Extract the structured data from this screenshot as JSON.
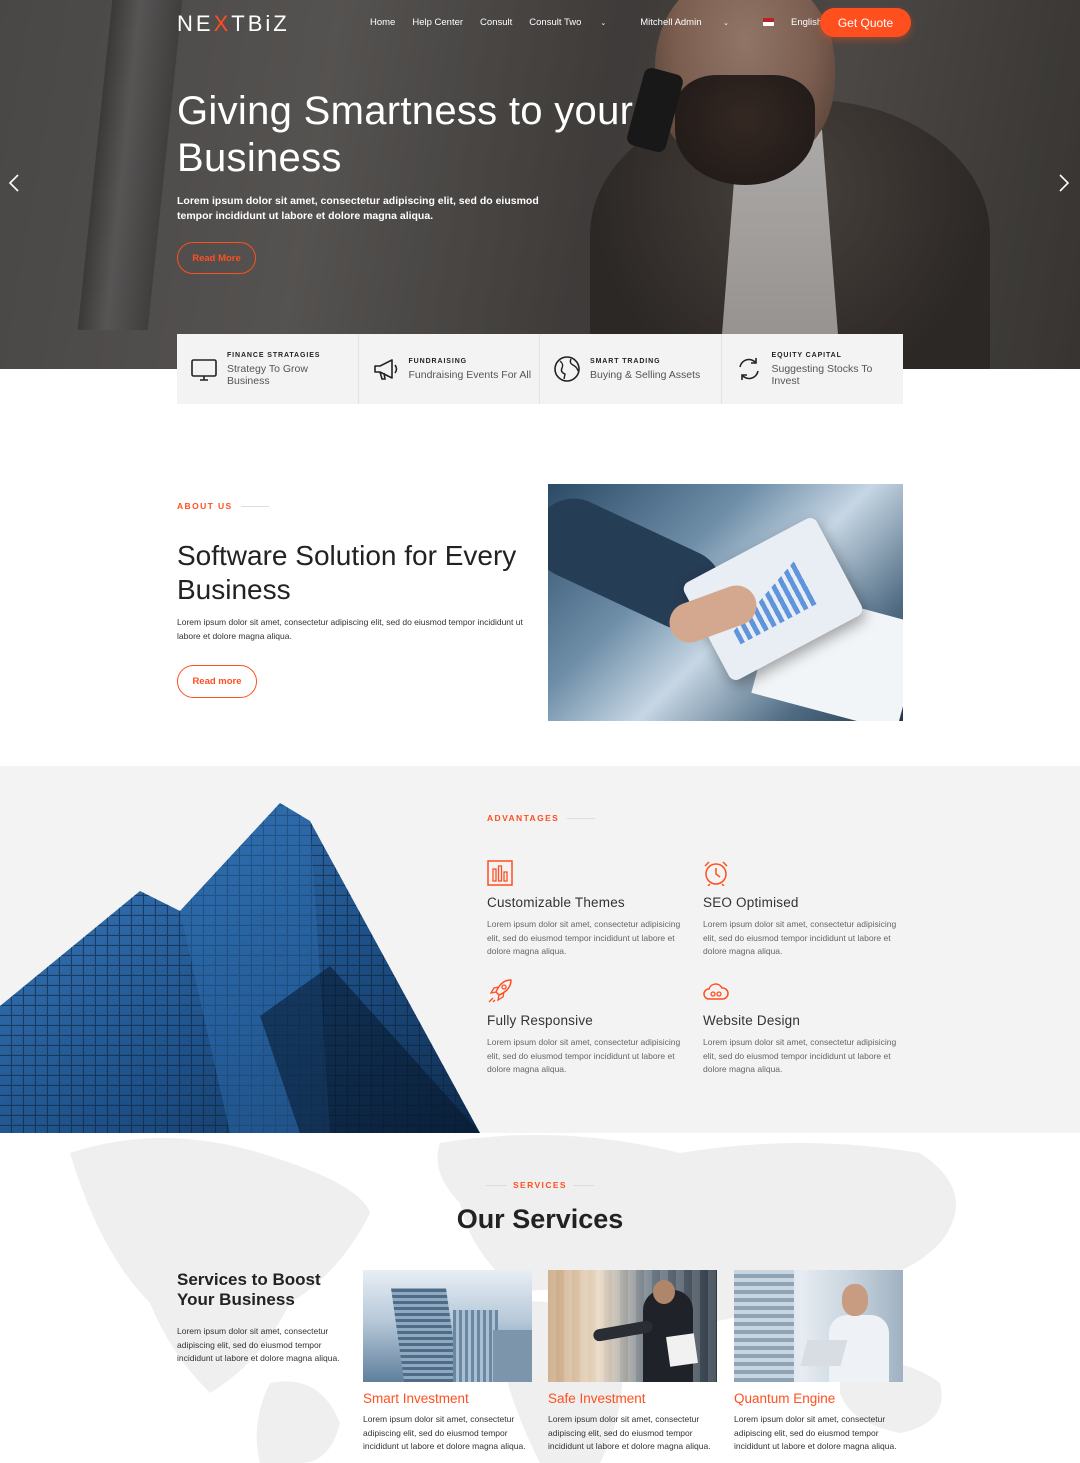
{
  "brand": {
    "logo_pre": "NE",
    "logo_x": "X",
    "logo_post": "TBiZ",
    "accent": "#ff4f1f"
  },
  "nav": {
    "items": [
      "Home",
      "Help Center",
      "Consult",
      "Consult Two"
    ],
    "user": "Mitchell Admin",
    "language": "English (US)",
    "cta": "Get Quote"
  },
  "hero": {
    "title": "Giving Smartness to your Business",
    "text": "Lorem ipsum dolor sit amet, consectetur adipiscing elit, sed do eiusmod tempor incididunt ut labore et dolore magna aliqua.",
    "button": "Read More"
  },
  "features": [
    {
      "kicker": "FINANCE STRATAGIES",
      "desc": "Strategy To Grow Business",
      "icon": "monitor-icon"
    },
    {
      "kicker": "FUNDRAISING",
      "desc": "Fundraising Events For All",
      "icon": "megaphone-icon"
    },
    {
      "kicker": "SMART TRADING",
      "desc": "Buying & Selling Assets",
      "icon": "globe-icon"
    },
    {
      "kicker": "EQUITY CAPITAL",
      "desc": "Suggesting Stocks To Invest",
      "icon": "refresh-icon"
    }
  ],
  "about": {
    "eyebrow": "ABOUT US",
    "title": "Software Solution for Every Business",
    "text": "Lorem ipsum dolor sit amet, consectetur adipiscing elit, sed do eiusmod tempor incididunt ut labore et dolore magna aliqua.",
    "button": "Read more"
  },
  "advantages": {
    "eyebrow": "ADVANTAGES",
    "items": [
      {
        "title": "Customizable Themes",
        "text": "Lorem ipsum dolor sit amet, consectetur adipisicing elit, sed do eiusmod tempor incididunt ut labore et dolore magna aliqua.",
        "icon": "bar-chart-icon"
      },
      {
        "title": "SEO Optimised",
        "text": "Lorem ipsum dolor sit amet, consectetur adipisicing elit, sed do eiusmod tempor incididunt ut labore et dolore magna aliqua.",
        "icon": "alarm-clock-icon"
      },
      {
        "title": "Fully Responsive",
        "text": "Lorem ipsum dolor sit amet, consectetur adipisicing elit, sed do eiusmod tempor incididunt ut labore et dolore magna aliqua.",
        "icon": "rocket-icon"
      },
      {
        "title": "Website Design",
        "text": "Lorem ipsum dolor sit amet, consectetur adipisicing elit, sed do eiusmod tempor incididunt ut labore et dolore magna aliqua.",
        "icon": "cloud-icon"
      }
    ]
  },
  "services": {
    "eyebrow": "SERVICES",
    "title": "Our Services",
    "side_title": "Services to Boost Your Business",
    "side_text": "Lorem ipsum dolor sit amet, consectetur adipiscing elit, sed do eiusmod tempor incididunt ut labore et dolore magna aliqua.",
    "cards": [
      {
        "title": "Smart Investment",
        "text": "Lorem ipsum dolor sit amet, consectetur adipiscing elit, sed do eiusmod tempor incididunt ut labore et dolore magna aliqua."
      },
      {
        "title": "Safe Investment",
        "text": "Lorem ipsum dolor sit amet, consectetur adipiscing elit, sed do eiusmod tempor incididunt ut labore et dolore magna aliqua."
      },
      {
        "title": "Quantum Engine",
        "text": "Lorem ipsum dolor sit amet, consectetur adipiscing elit, sed do eiusmod tempor incididunt ut labore et dolore magna aliqua."
      }
    ]
  }
}
